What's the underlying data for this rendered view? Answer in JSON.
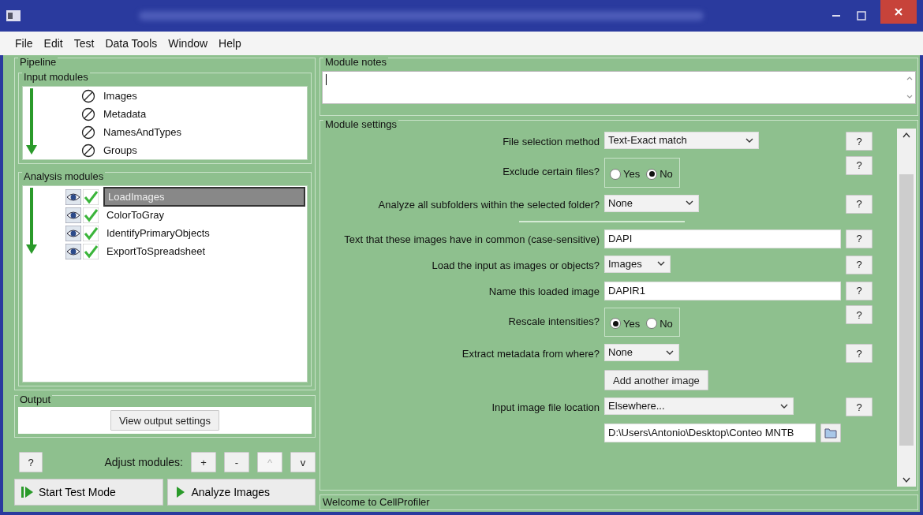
{
  "menu": [
    "File",
    "Edit",
    "Test",
    "Data Tools",
    "Window",
    "Help"
  ],
  "pipeline": {
    "title": "Pipeline",
    "input_modules": {
      "title": "Input modules",
      "items": [
        "Images",
        "Metadata",
        "NamesAndTypes",
        "Groups"
      ]
    },
    "analysis_modules": {
      "title": "Analysis modules",
      "items": [
        {
          "name": "LoadImages",
          "selected": true
        },
        {
          "name": "ColorToGray",
          "selected": false
        },
        {
          "name": "IdentifyPrimaryObjects",
          "selected": false
        },
        {
          "name": "ExportToSpreadsheet",
          "selected": false
        }
      ]
    }
  },
  "output": {
    "title": "Output",
    "button": "View output settings"
  },
  "adjust": {
    "help": "?",
    "label": "Adjust modules:",
    "buttons": [
      {
        "label": "+",
        "disabled": false
      },
      {
        "label": "-",
        "disabled": false
      },
      {
        "label": "^",
        "disabled": true
      },
      {
        "label": "v",
        "disabled": false
      }
    ]
  },
  "run_buttons": [
    {
      "label": "Start Test Mode",
      "kind": "test"
    },
    {
      "label": "Analyze Images",
      "kind": "analyze"
    }
  ],
  "module_notes": {
    "title": "Module notes"
  },
  "module_settings": {
    "title": "Module settings",
    "rows": [
      {
        "kind": "select",
        "label": "File selection method",
        "value": "Text-Exact match",
        "help": "?"
      },
      {
        "kind": "radio",
        "label": "Exclude certain files?",
        "options": [
          {
            "label": "Yes",
            "selected": false
          },
          {
            "label": "No",
            "selected": true
          }
        ],
        "help": "?"
      },
      {
        "kind": "select",
        "label": "Analyze all subfolders within the selected folder?",
        "value": "None",
        "help": "?"
      },
      {
        "kind": "divider"
      },
      {
        "kind": "text",
        "label": "Text that these images have in common (case-sensitive)",
        "value": "DAPI",
        "help": "?"
      },
      {
        "kind": "select",
        "label": "Load the input as images or objects?",
        "value": "Images",
        "help": "?"
      },
      {
        "kind": "text",
        "label": "Name this loaded image",
        "value": "DAPIR1",
        "help": "?"
      },
      {
        "kind": "radio",
        "label": "Rescale intensities?",
        "options": [
          {
            "label": "Yes",
            "selected": true
          },
          {
            "label": "No",
            "selected": false
          }
        ],
        "help": "?"
      },
      {
        "kind": "select",
        "label": "Extract metadata from where?",
        "value": "None",
        "help": "?"
      },
      {
        "kind": "button",
        "label": "Add another image"
      },
      {
        "kind": "select",
        "label": "Input image file location",
        "value": "Elsewhere...",
        "help": "?"
      },
      {
        "kind": "path",
        "value": "D:\\Users\\Antonio\\Desktop\\Conteo MNTB"
      }
    ]
  },
  "status_bar": "Welcome to CellProfiler"
}
